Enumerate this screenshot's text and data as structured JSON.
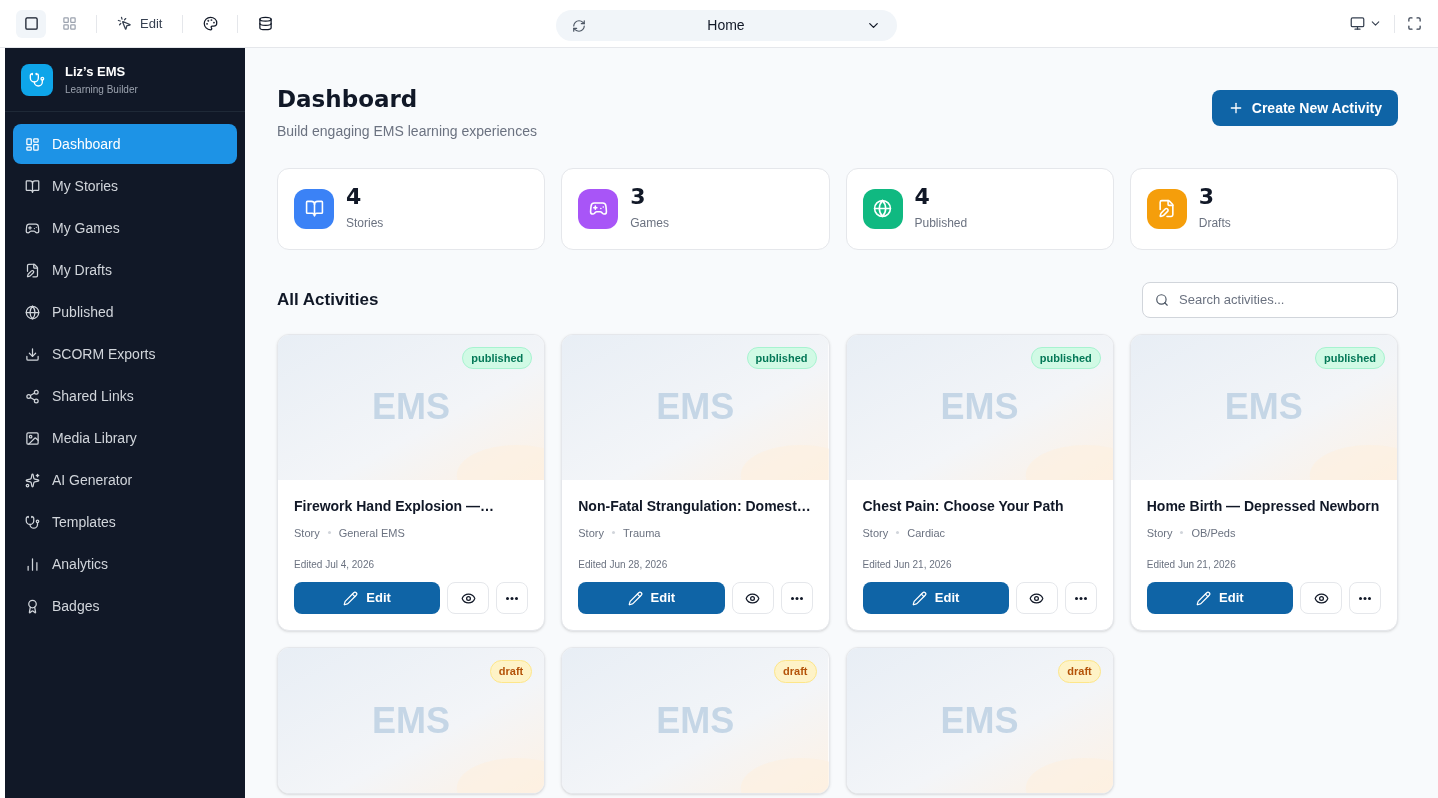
{
  "toolbar": {
    "edit_label": "Edit",
    "address": "Home"
  },
  "brand": {
    "name": "Liz’s EMS",
    "subtitle": "Learning Builder"
  },
  "sidebar": {
    "items": [
      {
        "kind": "dashboard",
        "label": "Dashboard",
        "selected": true
      },
      {
        "kind": "stories",
        "label": "My Stories",
        "selected": false
      },
      {
        "kind": "games",
        "label": "My Games",
        "selected": false
      },
      {
        "kind": "drafts",
        "label": "My Drafts",
        "selected": false
      },
      {
        "kind": "published",
        "label": "Published",
        "selected": false
      },
      {
        "kind": "exports",
        "label": "SCORM Exports",
        "selected": false
      },
      {
        "kind": "links",
        "label": "Shared Links",
        "selected": false
      },
      {
        "kind": "media",
        "label": "Media Library",
        "selected": false
      },
      {
        "kind": "ai",
        "label": "AI Generator",
        "selected": false
      },
      {
        "kind": "templates",
        "label": "Templates",
        "selected": false
      },
      {
        "kind": "analytics",
        "label": "Analytics",
        "selected": false
      },
      {
        "kind": "badges",
        "label": "Badges",
        "selected": false
      }
    ]
  },
  "header": {
    "title": "Dashboard",
    "subtitle": "Build engaging EMS learning experiences",
    "create_button": "Create New Activity"
  },
  "stats": [
    {
      "kind": "stories",
      "value": "4",
      "label": "Stories",
      "color": "#3b82f6"
    },
    {
      "kind": "games",
      "value": "3",
      "label": "Games",
      "color": "#a855f7"
    },
    {
      "kind": "published",
      "value": "4",
      "label": "Published",
      "color": "#10b981"
    },
    {
      "kind": "drafts",
      "value": "3",
      "label": "Drafts",
      "color": "#f59e0b"
    }
  ],
  "activities": {
    "title": "All Activities",
    "search_placeholder": "Search activities...",
    "cards": [
      {
        "status": "published",
        "thumbnail_text": "EMS",
        "title": "Firework Hand Explosion —…",
        "type": "Story",
        "category": "General EMS",
        "edited": "Edited Jul 4, 2026",
        "edit_button": "Edit"
      },
      {
        "status": "published",
        "thumbnail_text": "EMS",
        "title": "Non-Fatal Strangulation: Domest…",
        "type": "Story",
        "category": "Trauma",
        "edited": "Edited Jun 28, 2026",
        "edit_button": "Edit"
      },
      {
        "status": "published",
        "thumbnail_text": "EMS",
        "title": "Chest Pain: Choose Your Path",
        "type": "Story",
        "category": "Cardiac",
        "edited": "Edited Jun 21, 2026",
        "edit_button": "Edit"
      },
      {
        "status": "published",
        "thumbnail_text": "EMS",
        "title": "Home Birth — Depressed Newborn",
        "type": "Story",
        "category": "OB/Peds",
        "edited": "Edited Jun 21, 2026",
        "edit_button": "Edit"
      },
      {
        "status": "draft",
        "thumbnail_text": "EMS"
      },
      {
        "status": "draft",
        "thumbnail_text": "EMS"
      },
      {
        "status": "draft",
        "thumbnail_text": "EMS"
      }
    ]
  }
}
